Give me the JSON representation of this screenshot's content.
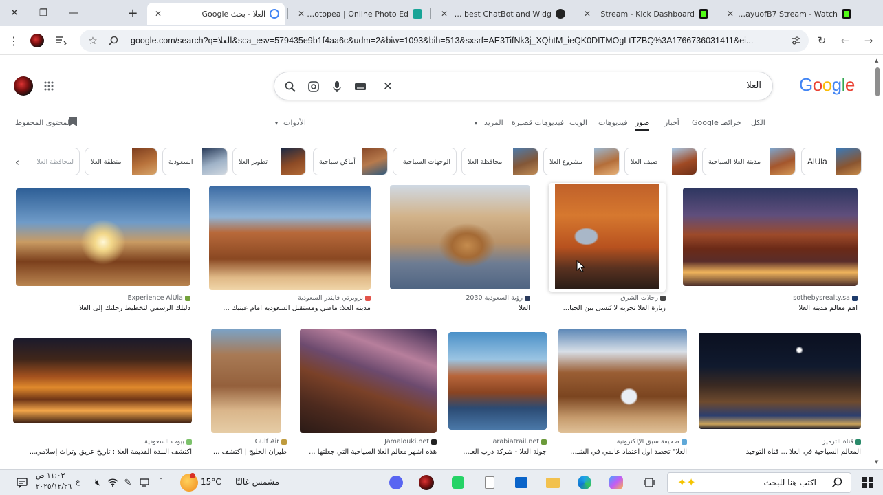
{
  "window": {
    "close_label": "✕",
    "restore_label": "❐",
    "minimize_label": "—",
    "new_tab_label": "+"
  },
  "tabs": [
    {
      "title": "العلا - بحث Google",
      "close": "✕"
    },
    {
      "title": "Photopea | Online Photo Ed",
      "close": "✕"
    },
    {
      "title": "The best ChatBot and Widg",
      "close": "✕"
    },
    {
      "title": "Stream - Kick Dashboard",
      "close": "✕"
    },
    {
      "title": "AlmayuofB7 Stream - Watch",
      "close": "✕"
    }
  ],
  "toolbar": {
    "url": "google.com/search?q=العلا&sca_esv=579435e9b1f4aa6c&udm=2&biw=1093&bih=513&sxsrf=AE3TifNk3j_XQhtM_ieQK0DITMOgLtTZBQ%3A1766736031411&ei..."
  },
  "search": {
    "query": "العلا"
  },
  "logo": {
    "letters": [
      "G",
      "o",
      "o",
      "g",
      "l",
      "e"
    ],
    "colors": [
      "#4285f4",
      "#ea4335",
      "#fbbc05",
      "#4285f4",
      "#34a853",
      "#ea4335"
    ]
  },
  "nav": {
    "items": [
      "الكل",
      "خرائط Google",
      "أخبار",
      "صور",
      "فيديوهات",
      "الويب",
      "فيديوهات قصيرة",
      "المزيد"
    ],
    "selected": "صور",
    "tools": "الأدوات",
    "saved": "المحتوى المحفوظ"
  },
  "chips": [
    "AlUla",
    "مدينة العلا السياحية",
    "صيف العلا",
    "مشروع العلا",
    "محافظة العلا",
    "الوجهات السياحية",
    "أماكن سياحية",
    "تطوير العلا",
    "السعودية",
    "منطقة العلا",
    "لمحافظة العلا"
  ],
  "results": [
    {
      "source": "Experience AlUla",
      "caption": "دليلك الرسمي لتخطيط رحلتك إلى العلا"
    },
    {
      "source": "بروبرتي فايندر السعودية",
      "caption": "مدينة العلا: ماضي ومستقبل السعودية أمام عينيك ..."
    },
    {
      "source": "رؤية السعودية 2030",
      "caption": "العلا"
    },
    {
      "source": "رحلات الشرق",
      "caption": "زيارة العلا تجربة لا تُنسى بين الجبا..."
    },
    {
      "source": "sothebysrealty.sa",
      "caption": "أهم معالم مدينة العلا"
    },
    {
      "source": "بيوت السعودية",
      "caption": "اكتشف البلدة القديمة العلا : تاريخ عريق وتراث إسلامي..."
    },
    {
      "source": "Gulf Air",
      "caption": "طيران الخليج | اكتشف ..."
    },
    {
      "source": "Jamalouki.net",
      "caption": "هذه اشهر معالم العلا السياحية التي جعلتها ..."
    },
    {
      "source": "arabiatrail.net",
      "caption": "جولة العلا - شركة درب العـ..."
    },
    {
      "source": "صحيفة سبق الإلكترونية",
      "caption": "العلا\" تحصد أول اعتماد عالمي في الشـ..."
    },
    {
      "source": "قناة الترميز",
      "caption": "المعالم السياحية في العلا ... قناة التوحيد"
    }
  ],
  "taskbar": {
    "search_text": "اكتب هنا للبحث",
    "weather": "مشمس غالبًا",
    "temperature": "15°C",
    "time": "١١:٠٣ ص",
    "date": "٢٠٢٥/١٢/٢٦"
  }
}
